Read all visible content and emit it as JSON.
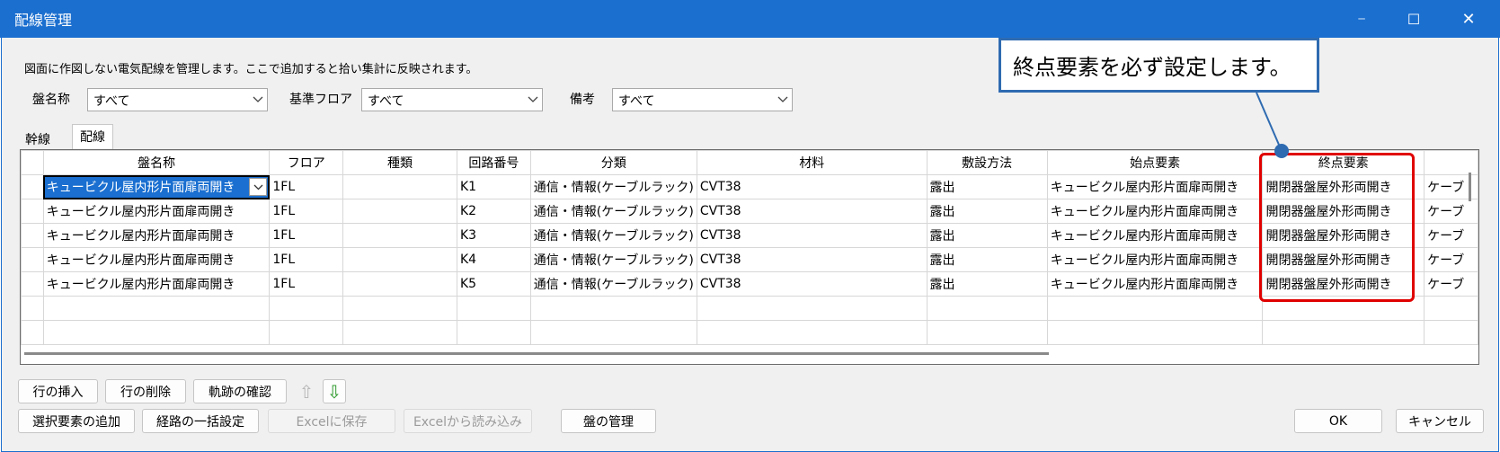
{
  "window": {
    "title": "配線管理",
    "controls": [
      "─",
      "☐",
      "✕"
    ]
  },
  "description": "図面に作図しない電気配線を管理します。ここで追加すると拾い集計に反映されます。",
  "filters": [
    {
      "label": "盤名称",
      "value": "すべて"
    },
    {
      "label": "基準フロア",
      "value": "すべて"
    },
    {
      "label": "備考",
      "value": "すべて"
    }
  ],
  "tabs": [
    {
      "label": "幹線",
      "active": false
    },
    {
      "label": "配線",
      "active": true
    }
  ],
  "grid": {
    "columns": [
      "盤名称",
      "フロア",
      "種類",
      "回路番号",
      "分類",
      "材料",
      "敷設方法",
      "始点要素",
      "終点要素",
      ""
    ],
    "rows": [
      [
        "キュービクル屋内形片面扉両開き",
        "1FL",
        "",
        "K1",
        "通信・情報(ケーブルラック)",
        "CVT38",
        "露出",
        "キュービクル屋内形片面扉両開き",
        "開閉器盤屋外形両開き",
        "ケーブ"
      ],
      [
        "キュービクル屋内形片面扉両開き",
        "1FL",
        "",
        "K2",
        "通信・情報(ケーブルラック)",
        "CVT38",
        "露出",
        "キュービクル屋内形片面扉両開き",
        "開閉器盤屋外形両開き",
        "ケーブ"
      ],
      [
        "キュービクル屋内形片面扉両開き",
        "1FL",
        "",
        "K3",
        "通信・情報(ケーブルラック)",
        "CVT38",
        "露出",
        "キュービクル屋内形片面扉両開き",
        "開閉器盤屋外形両開き",
        "ケーブ"
      ],
      [
        "キュービクル屋内形片面扉両開き",
        "1FL",
        "",
        "K4",
        "通信・情報(ケーブルラック)",
        "CVT38",
        "露出",
        "キュービクル屋内形片面扉両開き",
        "開閉器盤屋外形両開き",
        "ケーブ"
      ],
      [
        "キュービクル屋内形片面扉両開き",
        "1FL",
        "",
        "K5",
        "通信・情報(ケーブルラック)",
        "CVT38",
        "露出",
        "キュービクル屋内形片面扉両開き",
        "開閉器盤屋外形両開き",
        "ケーブ"
      ]
    ]
  },
  "buttons": {
    "insert_row": "行の挿入",
    "delete_row": "行の削除",
    "check_trace": "軌跡の確認",
    "up_arrow": "⇧",
    "down_arrow": "⇩",
    "add_selected": "選択要素の追加",
    "bulk_route": "経路の一括設定",
    "save_excel": "Excelに保存",
    "load_excel": "Excelから読み込み",
    "panel_manage": "盤の管理",
    "ok": "OK",
    "cancel": "キャンセル"
  },
  "callout": {
    "text": "終点要素を必ず設定します。"
  },
  "colors": {
    "title_bar": "#1b6fcf",
    "selection": "#1a6fd0",
    "highlight": "#e00000",
    "callout_border": "#2f6bb1",
    "down_arrow": "#2e9a2e"
  }
}
